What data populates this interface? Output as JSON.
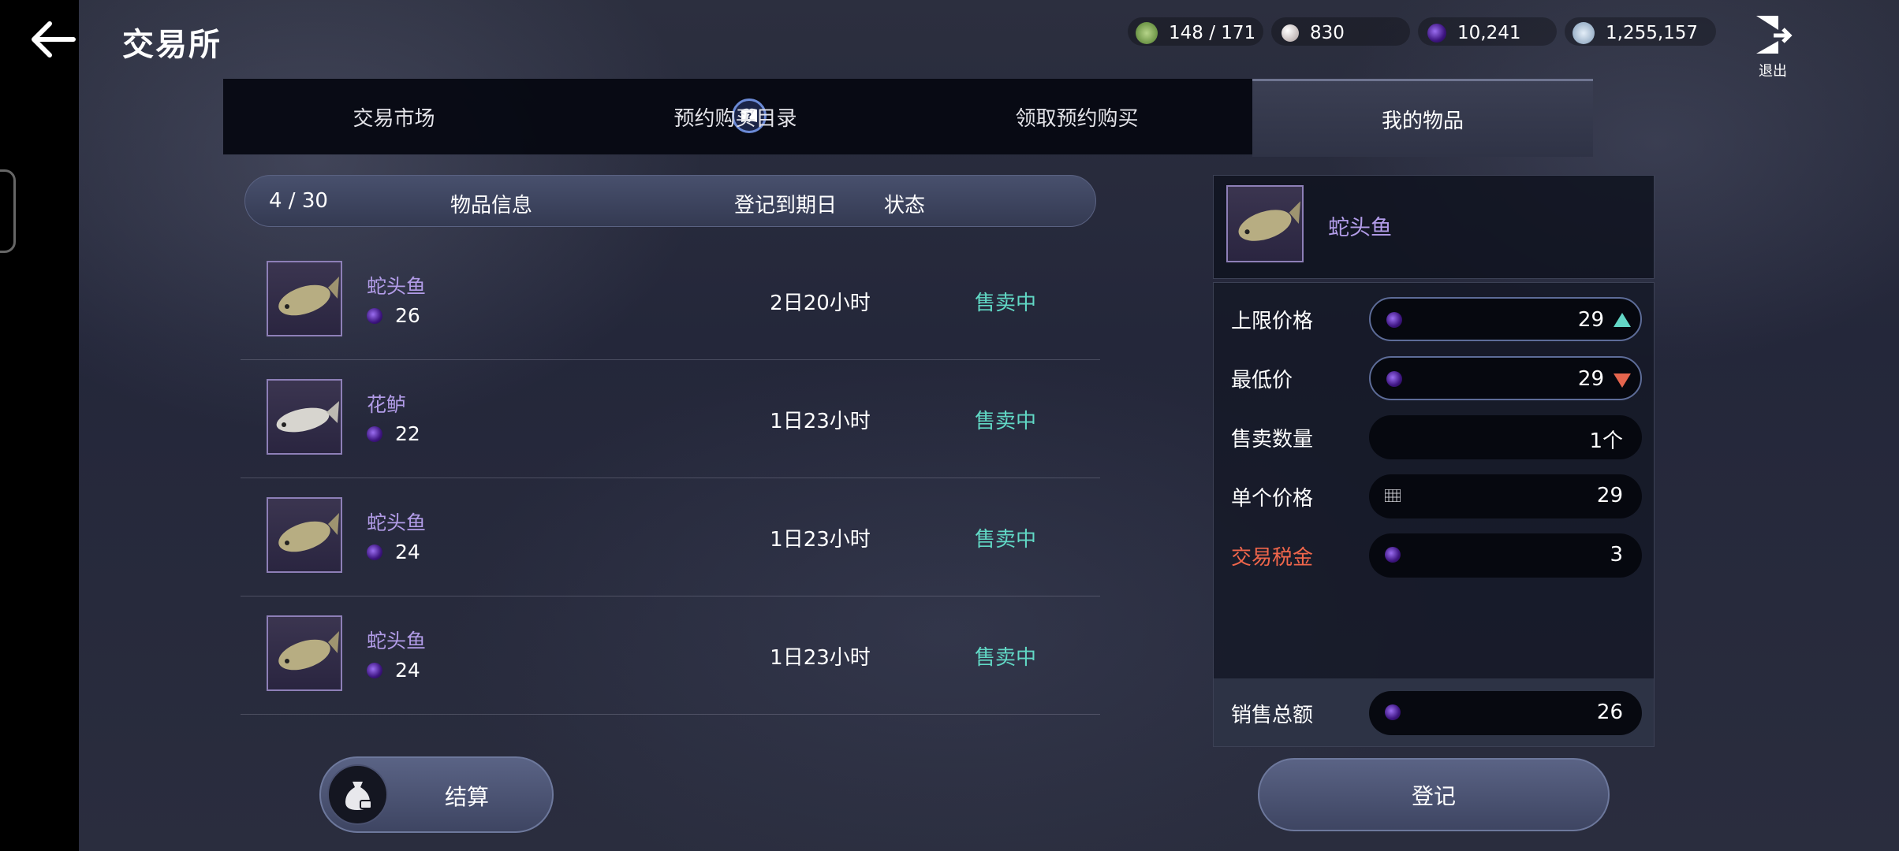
{
  "header": {
    "title": "交易所",
    "exit_label": "退出",
    "currencies": [
      {
        "icon": "energy-icon",
        "value": "148 / 171",
        "color": "#7fa860"
      },
      {
        "icon": "pearl-icon",
        "value": "830",
        "color": "#d8cfcf"
      },
      {
        "icon": "purple-orb-icon",
        "value": "10,241",
        "color": "#6a2bd0"
      },
      {
        "icon": "silver-coin-icon",
        "value": "1,255,157",
        "color": "#b8cbe0"
      }
    ]
  },
  "tabs": [
    {
      "label": "交易市场",
      "active": false
    },
    {
      "label": "预约购买目录",
      "active": false
    },
    {
      "label": "领取预约购买",
      "active": false
    },
    {
      "label": "我的物品",
      "active": true
    }
  ],
  "list": {
    "count": "4 / 30",
    "columns": {
      "info": "物品信息",
      "expiry": "登记到期日",
      "status": "状态"
    },
    "rows": [
      {
        "name": "蛇头鱼",
        "price": "26",
        "expiry": "2日20小时",
        "status": "售卖中",
        "fish": "snakehead-fish-icon"
      },
      {
        "name": "花鲈",
        "price": "22",
        "expiry": "1日23小时",
        "status": "售卖中",
        "fish": "sea-bass-icon"
      },
      {
        "name": "蛇头鱼",
        "price": "24",
        "expiry": "1日23小时",
        "status": "售卖中",
        "fish": "snakehead-fish-icon"
      },
      {
        "name": "蛇头鱼",
        "price": "24",
        "expiry": "1日23小时",
        "status": "售卖中",
        "fish": "snakehead-fish-icon"
      }
    ]
  },
  "detail": {
    "name": "蛇头鱼",
    "fields": {
      "max_price": {
        "label": "上限价格",
        "value": "29"
      },
      "min_price": {
        "label": "最低价",
        "value": "29"
      },
      "quantity": {
        "label": "售卖数量",
        "value": "1个"
      },
      "unit_price": {
        "label": "单个价格",
        "value": "29"
      },
      "tax": {
        "label": "交易税金",
        "value": "3"
      },
      "total": {
        "label": "销售总额",
        "value": "26"
      }
    },
    "colors": {
      "tax_label": "#f0664b",
      "name": "#b29ce8",
      "status": "#61d8c5"
    }
  },
  "buttons": {
    "settle": "结算",
    "register": "登记"
  }
}
